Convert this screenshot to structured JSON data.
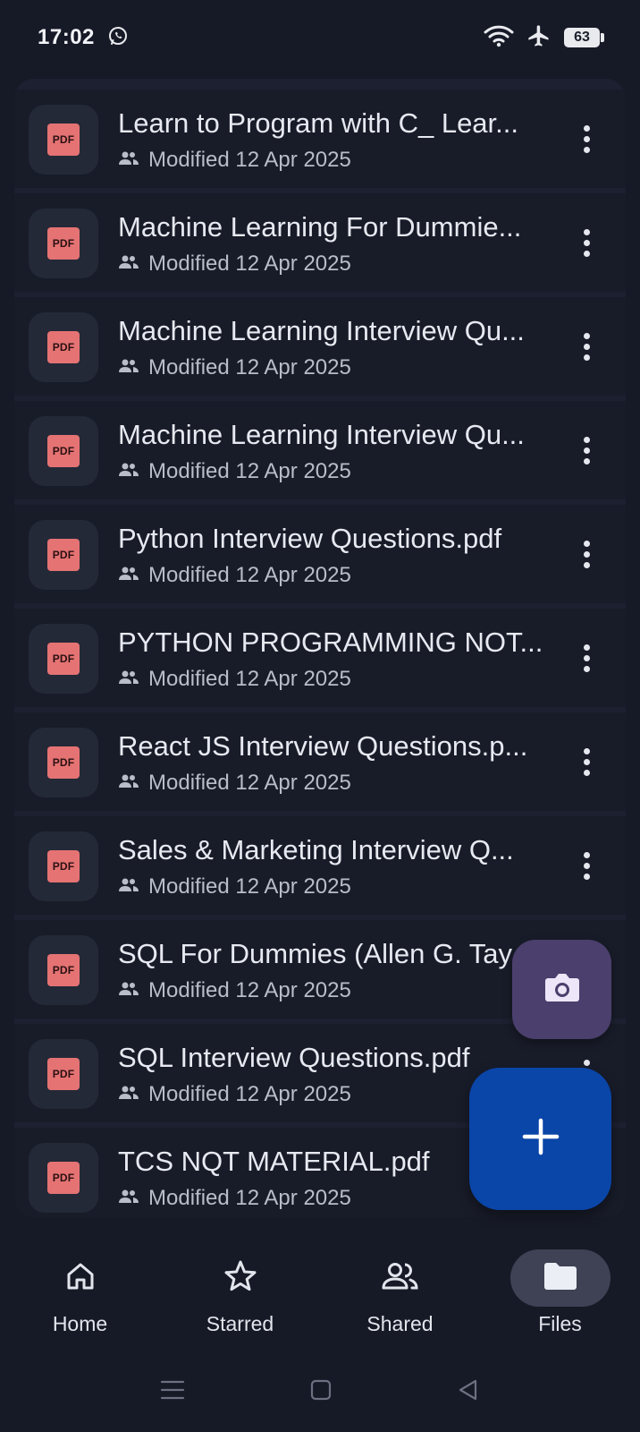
{
  "status_bar": {
    "time": "17:02",
    "battery": "63",
    "icons": [
      "whatsapp-icon",
      "wifi-icon",
      "airplane-icon",
      "battery-icon"
    ]
  },
  "files": [
    {
      "name": "Learn to Program with C_ Lear...",
      "meta": "Modified 12 Apr 2025",
      "type": "PDF"
    },
    {
      "name": "Machine Learning For Dummie...",
      "meta": "Modified 12 Apr 2025",
      "type": "PDF"
    },
    {
      "name": "Machine Learning Interview Qu...",
      "meta": "Modified 12 Apr 2025",
      "type": "PDF"
    },
    {
      "name": "Machine Learning Interview Qu...",
      "meta": "Modified 12 Apr 2025",
      "type": "PDF"
    },
    {
      "name": "Python Interview Questions.pdf",
      "meta": "Modified 12 Apr 2025",
      "type": "PDF"
    },
    {
      "name": "PYTHON PROGRAMMING NOT...",
      "meta": "Modified 12 Apr 2025",
      "type": "PDF"
    },
    {
      "name": "React JS Interview Questions.p...",
      "meta": "Modified 12 Apr 2025",
      "type": "PDF"
    },
    {
      "name": "Sales & Marketing Interview Q...",
      "meta": "Modified 12 Apr 2025",
      "type": "PDF"
    },
    {
      "name": "SQL For Dummies (Allen G. Tay",
      "meta": "Modified 12 Apr 2025",
      "type": "PDF"
    },
    {
      "name": "SQL Interview Questions.pdf",
      "meta": "Modified 12 Apr 2025",
      "type": "PDF"
    },
    {
      "name": "TCS NQT MATERIAL.pdf",
      "meta": "Modified 12 Apr 2025",
      "type": "PDF"
    }
  ],
  "nav": {
    "items": [
      {
        "label": "Home",
        "icon": "home-icon"
      },
      {
        "label": "Starred",
        "icon": "star-icon"
      },
      {
        "label": "Shared",
        "icon": "shared-people-icon"
      },
      {
        "label": "Files",
        "icon": "folder-icon"
      }
    ],
    "active": "Files"
  },
  "colors": {
    "background": "#161a27",
    "pdf_red": "#e57373",
    "fab_add": "#0a45a8",
    "fab_camera": "#4b3f6d",
    "nav_active_pill": "#3e4254"
  }
}
